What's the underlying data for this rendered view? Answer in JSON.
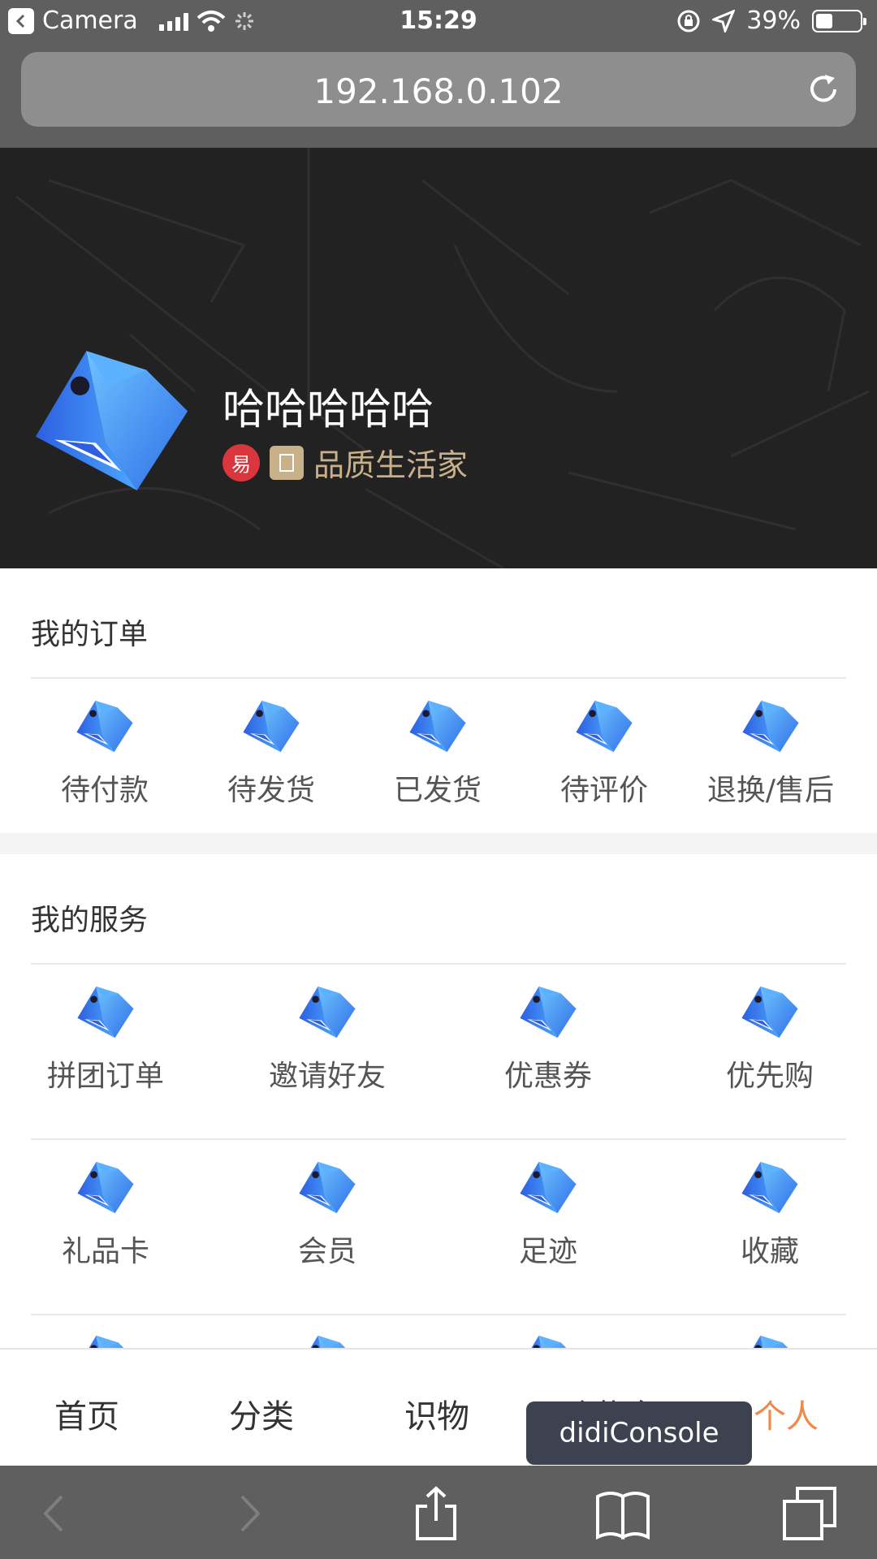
{
  "status_bar": {
    "back_app": "Camera",
    "time": "15:29",
    "battery": "39%",
    "battery_level": 0.39
  },
  "browser": {
    "url": "192.168.0.102"
  },
  "profile": {
    "username": "哈哈哈哈哈",
    "level_text": "品质生活家",
    "badge_text": "易"
  },
  "orders": {
    "title": "我的订单",
    "items": [
      {
        "label": "待付款"
      },
      {
        "label": "待发货"
      },
      {
        "label": "已发货"
      },
      {
        "label": "待评价"
      },
      {
        "label": "退换/售后"
      }
    ]
  },
  "services": {
    "title": "我的服务",
    "items": [
      {
        "label": "拼团订单"
      },
      {
        "label": "邀请好友"
      },
      {
        "label": "优惠券"
      },
      {
        "label": "优先购"
      },
      {
        "label": "礼品卡"
      },
      {
        "label": "会员"
      },
      {
        "label": "足迹"
      },
      {
        "label": "收藏"
      }
    ]
  },
  "tabbar": {
    "tabs": [
      {
        "label": "首页"
      },
      {
        "label": "分类"
      },
      {
        "label": "识物"
      },
      {
        "label": "购物车"
      },
      {
        "label": "个人"
      }
    ],
    "active_color": "#f0884a"
  },
  "console_button": "didiConsole",
  "colors": {
    "banner_bg": "#222223",
    "level_gold": "#c8b08a",
    "icon_blue": "#3d8ef0"
  }
}
